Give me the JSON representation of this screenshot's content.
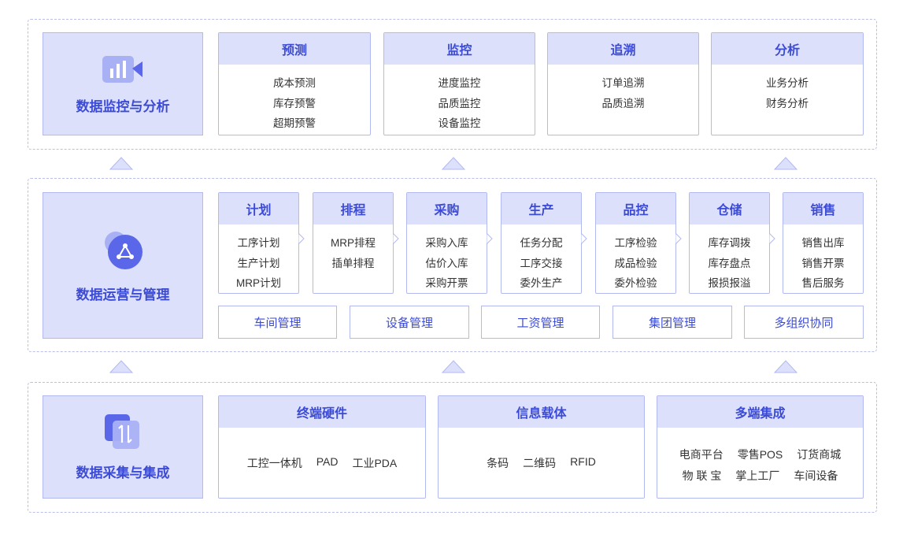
{
  "layers": {
    "analysis": {
      "title": "数据监控与分析",
      "icon": "video-chart-icon",
      "cards": [
        {
          "head": "预测",
          "items": [
            "成本预测",
            "库存预警",
            "超期预警"
          ]
        },
        {
          "head": "监控",
          "items": [
            "进度监控",
            "品质监控",
            "设备监控"
          ]
        },
        {
          "head": "追溯",
          "items": [
            "订单追溯",
            "品质追溯"
          ]
        },
        {
          "head": "分析",
          "items": [
            "业务分析",
            "财务分析"
          ]
        }
      ]
    },
    "operations": {
      "title": "数据运营与管理",
      "icon": "share-network-icon",
      "cards": [
        {
          "head": "计划",
          "items": [
            "工序计划",
            "生产计划",
            "MRP计划"
          ]
        },
        {
          "head": "排程",
          "items": [
            "MRP排程",
            "插单排程"
          ]
        },
        {
          "head": "采购",
          "items": [
            "采购入库",
            "估价入库",
            "采购开票"
          ]
        },
        {
          "head": "生产",
          "items": [
            "任务分配",
            "工序交接",
            "委外生产"
          ]
        },
        {
          "head": "品控",
          "items": [
            "工序检验",
            "成品检验",
            "委外检验"
          ]
        },
        {
          "head": "仓储",
          "items": [
            "库存调拨",
            "库存盘点",
            "报损报溢"
          ]
        },
        {
          "head": "销售",
          "items": [
            "销售出库",
            "销售开票",
            "售后服务"
          ]
        }
      ],
      "management": [
        "车间管理",
        "设备管理",
        "工资管理",
        "集团管理",
        "多组织协同"
      ]
    },
    "collection": {
      "title": "数据采集与集成",
      "icon": "transfer-arrows-icon",
      "cards": [
        {
          "head": "终端硬件",
          "rows": [
            [
              "工控一体机",
              "PAD",
              "工业PDA"
            ]
          ]
        },
        {
          "head": "信息载体",
          "rows": [
            [
              "条码",
              "二维码",
              "RFID"
            ]
          ]
        },
        {
          "head": "多端集成",
          "rows": [
            [
              "电商平台",
              "零售POS",
              "订货商城"
            ],
            [
              "物 联 宝",
              "掌上工厂",
              "车间设备"
            ]
          ]
        }
      ]
    }
  },
  "colors": {
    "accent": "#3c4bd6",
    "header_bg": "#dde0fb",
    "border": "#b2b9f0",
    "dashed": "#b9bfe8"
  }
}
